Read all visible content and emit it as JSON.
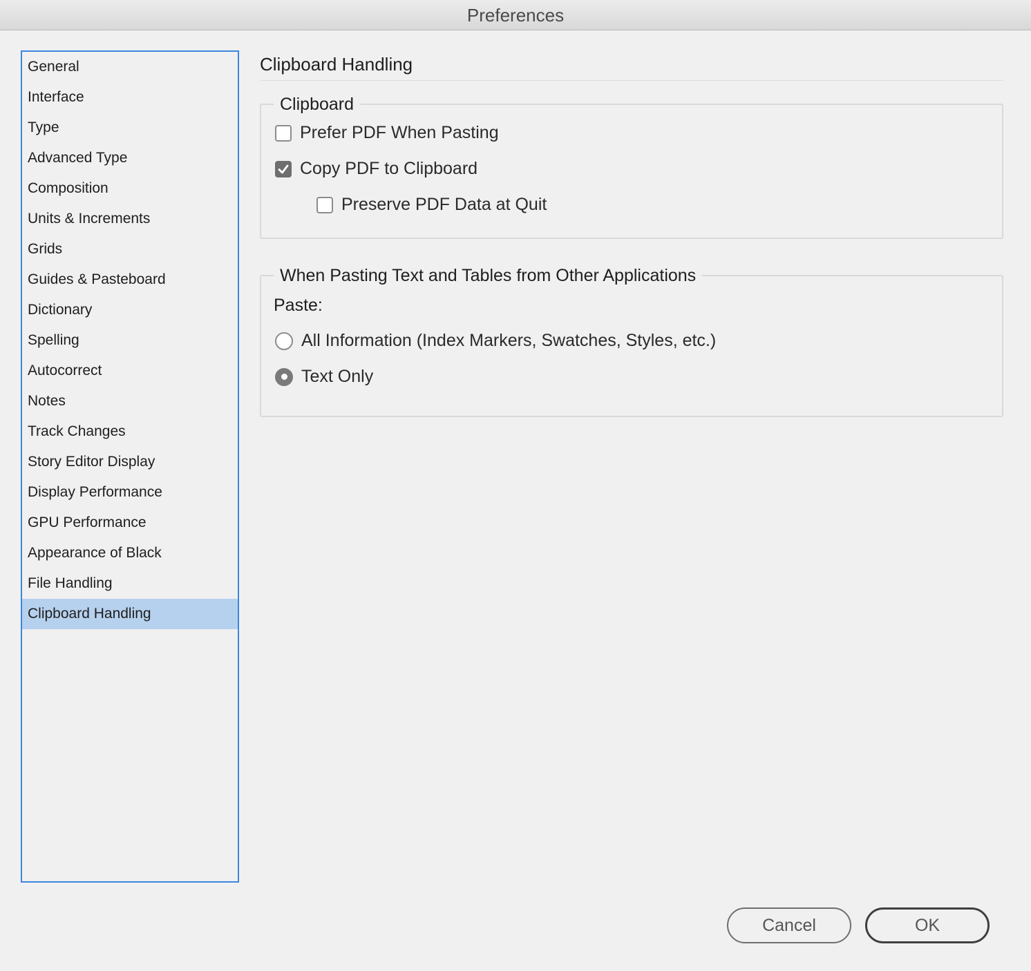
{
  "window": {
    "title": "Preferences"
  },
  "sidebar": {
    "items": [
      {
        "label": "General"
      },
      {
        "label": "Interface"
      },
      {
        "label": "Type"
      },
      {
        "label": "Advanced Type"
      },
      {
        "label": "Composition"
      },
      {
        "label": "Units & Increments"
      },
      {
        "label": "Grids"
      },
      {
        "label": "Guides & Pasteboard"
      },
      {
        "label": "Dictionary"
      },
      {
        "label": "Spelling"
      },
      {
        "label": "Autocorrect"
      },
      {
        "label": "Notes"
      },
      {
        "label": "Track Changes"
      },
      {
        "label": "Story Editor Display"
      },
      {
        "label": "Display Performance"
      },
      {
        "label": "GPU Performance"
      },
      {
        "label": "Appearance of Black"
      },
      {
        "label": "File Handling"
      },
      {
        "label": "Clipboard Handling",
        "selected": true
      }
    ],
    "selected_index": 18
  },
  "main": {
    "title": "Clipboard Handling",
    "clipboard_group": {
      "legend": "Clipboard",
      "prefer_pdf": {
        "label": "Prefer PDF When Pasting",
        "checked": false
      },
      "copy_pdf": {
        "label": "Copy PDF to Clipboard",
        "checked": true
      },
      "preserve_pdf": {
        "label": "Preserve PDF Data at Quit",
        "checked": false
      }
    },
    "paste_group": {
      "legend": "When Pasting Text and Tables from Other Applications",
      "paste_label": "Paste:",
      "options": [
        {
          "label": "All Information (Index Markers, Swatches, Styles, etc.)",
          "selected": false
        },
        {
          "label": "Text Only",
          "selected": true
        }
      ]
    }
  },
  "footer": {
    "cancel_label": "Cancel",
    "ok_label": "OK"
  },
  "colors": {
    "accent": "#3b86e0",
    "selection": "#b6d1ee"
  }
}
